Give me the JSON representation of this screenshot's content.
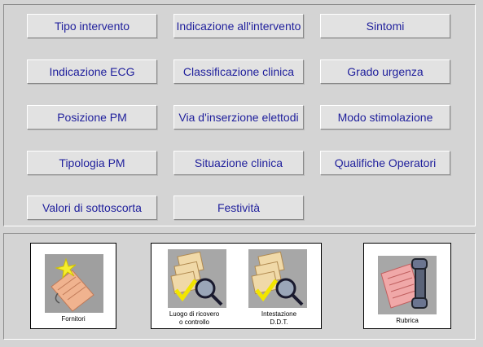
{
  "buttons": {
    "tipo_intervento": "Tipo intervento",
    "indicazione_intervento": "Indicazione all'intervento",
    "sintomi": "Sintomi",
    "indicazione_ecg": "Indicazione ECG",
    "classificazione_clinica": "Classificazione clinica",
    "grado_urgenza": "Grado urgenza",
    "posizione_pm": "Posizione PM",
    "via_inserzione": "Via d'inserzione elettodi",
    "modo_stimolazione": "Modo stimolazione",
    "tipologia_pm": "Tipologia PM",
    "situazione_clinica": "Situazione clinica",
    "qualifiche_operatori": "Qualifiche Operatori",
    "valori_sottoscorta": "Valori di sottoscorta",
    "festivita": "Festività"
  },
  "tiles": {
    "fornitori": "Fornitori",
    "luogo_line1": "Luogo di ricovero",
    "luogo_line2": "o controllo",
    "intestazione_line1": "Intestazione",
    "intestazione_line2": "D.D.T.",
    "rubrica": "Rubrica"
  },
  "icons": {
    "fornitori": "folder-star-icon",
    "luogo": "documents-magnifier-icon",
    "intestazione": "documents-magnifier-icon",
    "rubrica": "phone-notes-icon"
  },
  "colors": {
    "background": "#d4d4d4",
    "button_face": "#e2e2e2",
    "button_text": "#1f1f9c"
  }
}
